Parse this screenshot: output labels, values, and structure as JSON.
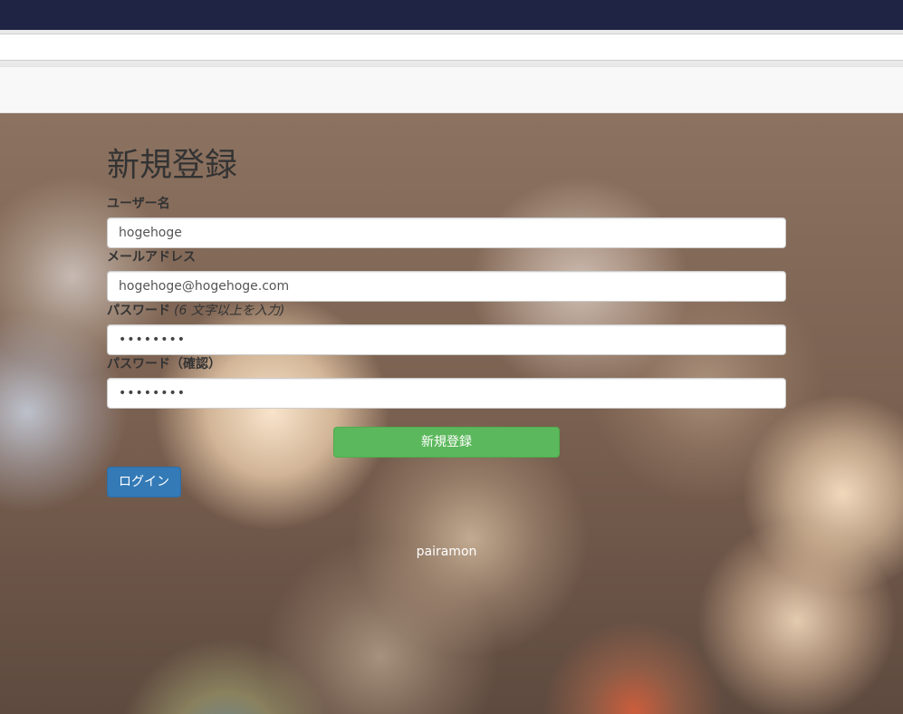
{
  "form": {
    "title": "新規登録",
    "username": {
      "label": "ユーザー名",
      "value": "hogehoge"
    },
    "email": {
      "label": "メールアドレス",
      "value": "hogehoge@hogehoge.com"
    },
    "password": {
      "label": "パスワード",
      "hint": "(6 文字以上を入力)",
      "value": "••••••••"
    },
    "password_confirm": {
      "label": "パスワード（確認）",
      "value": "••••••••"
    },
    "submit_label": "新規登録"
  },
  "login_label": "ログイン",
  "footer": {
    "text": "pairamon"
  },
  "colors": {
    "topbar": "#1f2444",
    "submit": "#5cb85c",
    "login": "#337ab7"
  }
}
